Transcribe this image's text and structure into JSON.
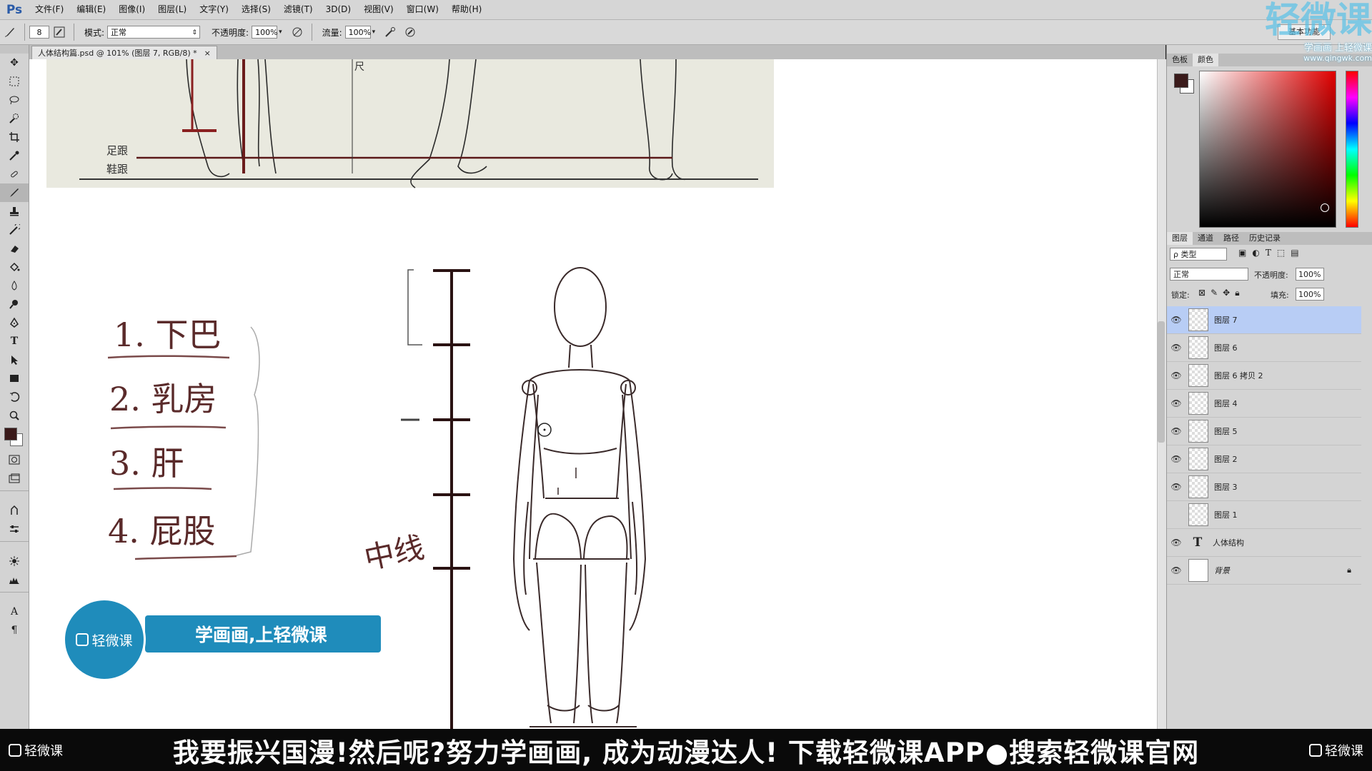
{
  "app": {
    "logo": "Ps"
  },
  "menu": [
    "文件(F)",
    "编辑(E)",
    "图像(I)",
    "图层(L)",
    "文字(Y)",
    "选择(S)",
    "滤镜(T)",
    "3D(D)",
    "视图(V)",
    "窗口(W)",
    "帮助(H)"
  ],
  "options": {
    "brush_size": "8",
    "mode_label": "模式:",
    "mode_value": "正常",
    "opacity_label": "不透明度:",
    "opacity_value": "100%",
    "flow_label": "流量:",
    "flow_value": "100%",
    "workspace": "基本功能"
  },
  "document": {
    "tab_title": "人体结构篇.psd @ 101% (图层 7, RGB/8) *",
    "close": "×"
  },
  "canvas": {
    "ref_labels": {
      "heel": "足跟",
      "shoe_heel": "鞋跟",
      "chi": "尺"
    },
    "notes": [
      "1. 下巴",
      "2. 乳房",
      "3. 肝",
      "4. 屁股"
    ],
    "side_note": "中线",
    "ad": {
      "logo_text": "轻微课",
      "slogan": "学画画,上轻微课"
    }
  },
  "color_panel": {
    "tabs": [
      "色板",
      "颜色"
    ],
    "active": 1,
    "fg": "#3a1a1a",
    "bg": "#ffffff"
  },
  "layers_panel": {
    "tabs": [
      "图层",
      "通道",
      "路径",
      "历史记录"
    ],
    "filter_label": "ρ 类型",
    "blend_mode": "正常",
    "opacity_label": "不透明度:",
    "opacity_value": "100%",
    "lock_label": "锁定:",
    "fill_label": "填充:",
    "fill_value": "100%",
    "layers": [
      {
        "name": "图层 7",
        "visible": true,
        "selected": true,
        "kind": "pixel"
      },
      {
        "name": "图层 6",
        "visible": true,
        "selected": false,
        "kind": "pixel"
      },
      {
        "name": "图层 6 拷贝 2",
        "visible": true,
        "selected": false,
        "kind": "pixel"
      },
      {
        "name": "图层 4",
        "visible": true,
        "selected": false,
        "kind": "pixel"
      },
      {
        "name": "图层 5",
        "visible": true,
        "selected": false,
        "kind": "pixel"
      },
      {
        "name": "图层 2",
        "visible": true,
        "selected": false,
        "kind": "pixel"
      },
      {
        "name": "图层 3",
        "visible": true,
        "selected": false,
        "kind": "pixel"
      },
      {
        "name": "图层 1",
        "visible": false,
        "selected": false,
        "kind": "pixel"
      },
      {
        "name": "人体结构",
        "visible": true,
        "selected": false,
        "kind": "text"
      },
      {
        "name": "背景",
        "visible": true,
        "selected": false,
        "kind": "background",
        "locked": true
      }
    ]
  },
  "banner": {
    "text": "我要振兴国漫!然后呢?努力学画画, 成为动漫达人! 下载轻微课APP●搜索轻微课官网",
    "logo_left": "轻微课",
    "logo_right": "轻微课"
  },
  "watermark": {
    "big": "轻微课",
    "line1": "学画画 上轻微课",
    "line2": "www.qingwk.com"
  }
}
